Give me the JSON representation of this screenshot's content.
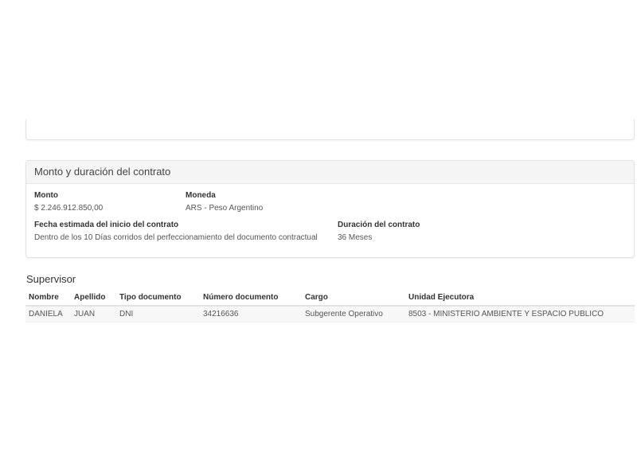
{
  "contract_panel": {
    "title": "Monto y duración del contrato",
    "monto": {
      "label": "Monto",
      "value": "$ 2.246.912.850,00"
    },
    "moneda": {
      "label": "Moneda",
      "value": "ARS - Peso Argentino"
    },
    "fecha_inicio": {
      "label": "Fecha estimada del inicio del contrato",
      "value": "Dentro de los 10 Días corridos del perfeccionamiento del documento contractual"
    },
    "duracion": {
      "label": "Duración del contrato",
      "value": "36 Meses"
    }
  },
  "supervisor": {
    "title": "Supervisor",
    "columns": [
      "Nombre",
      "Apellido",
      "Tipo documento",
      "Número documento",
      "Cargo",
      "Unidad Ejecutora"
    ],
    "rows": [
      [
        "DANIELA",
        "JUAN",
        "DNI",
        "34216636",
        "Subgerente Operativo",
        "8503 - MINISTERIO AMBIENTE Y ESPACIO PUBLICO"
      ]
    ]
  }
}
